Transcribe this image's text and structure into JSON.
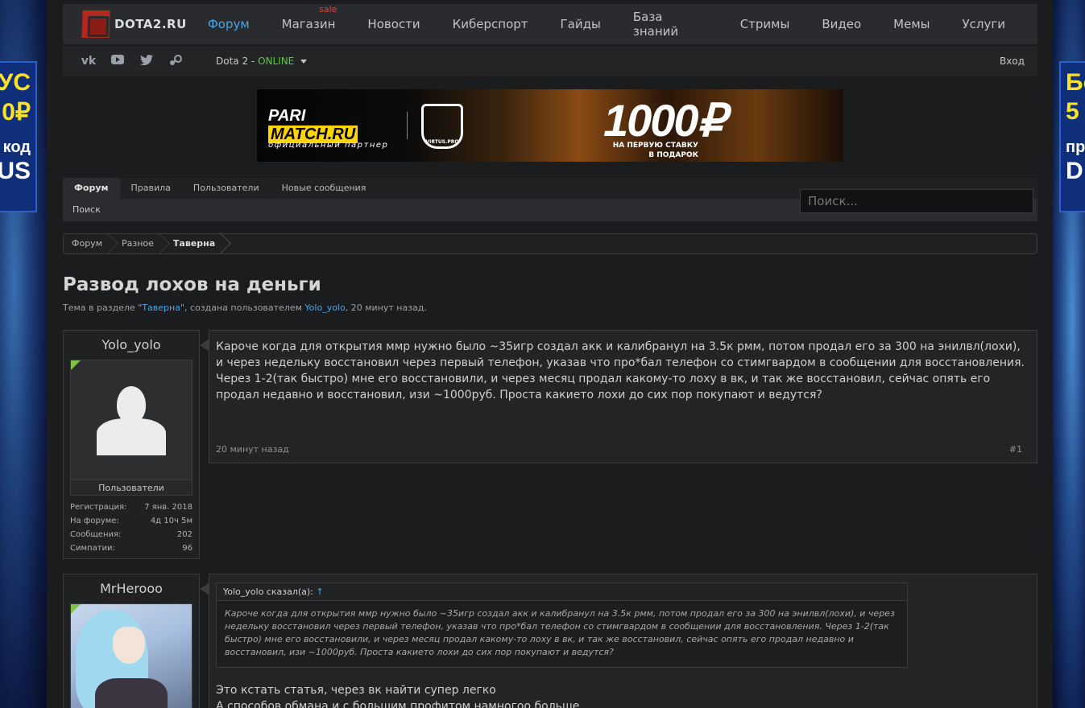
{
  "side_ads": {
    "left": {
      "line1": "УС",
      "line2": "0₽",
      "line3": "код",
      "line4": "US"
    },
    "right": {
      "line1": "Бо",
      "line2": "5",
      "line3": "пр",
      "line4": "D"
    }
  },
  "header": {
    "logo_text": "DOTA2.RU",
    "nav": [
      {
        "label": "Форум",
        "active": true
      },
      {
        "label": "Магазин",
        "badge": "sale"
      },
      {
        "label": "Новости"
      },
      {
        "label": "Киберспорт"
      },
      {
        "label": "Гайды"
      },
      {
        "label": "База знаний"
      },
      {
        "label": "Стримы"
      },
      {
        "label": "Видео"
      },
      {
        "label": "Мемы"
      },
      {
        "label": "Услуги"
      }
    ],
    "status_prefix": "Dota 2 - ",
    "status_value": "ONLINE",
    "login": "Вход"
  },
  "ad": {
    "brand1": "PARI",
    "brand2": "MATCH.RU",
    "partner": "официальный партнер",
    "team": "VIRTUS.PRO",
    "amount": "1000₽",
    "line1": "НА ПЕРВУЮ СТАВКУ",
    "line2": "В ПОДАРОК"
  },
  "forum_nav": {
    "tabs": [
      "Форум",
      "Правила",
      "Пользователи",
      "Новые сообщения"
    ],
    "sub": "Поиск",
    "search_placeholder": "Поиск..."
  },
  "breadcrumb": [
    "Форум",
    "Разное",
    "Таверна"
  ],
  "thread": {
    "title": "Развод лохов на деньги",
    "meta_prefix": "Тема в разделе \"",
    "meta_section": "Таверна",
    "meta_mid": "\", создана пользователем ",
    "meta_user": "Yolo_yolo",
    "meta_suffix": ", 20 минут назад."
  },
  "posts": [
    {
      "username": "Yolo_yolo",
      "group": "Пользователи",
      "stats": [
        {
          "label": "Регистрация:",
          "value": "7 янв. 2018"
        },
        {
          "label": "На форуме:",
          "value": "4д 10ч 5м"
        },
        {
          "label": "Сообщения:",
          "value": "202"
        },
        {
          "label": "Симпатии:",
          "value": "96"
        }
      ],
      "text": "Кароче когда для открытия ммр нужно было ~35игр создал акк и калибранул на 3.5к рмм, потом продал его за 300 на энилвл(лохи), и через недельку восстановил через первый телефон, указав что про*бал телефон со стимгвардом в сообщении для восстановления. Через 1-2(так быстро) мне его восстановили, и через месяц продал какому-то лоху в вк, и так же восстановил, сейчас опять его продал недавно и восстановил, изи ~1000руб. Проста какието лохи до сих пор покупают и ведутся?",
      "time": "20 минут назад",
      "number": "#1"
    },
    {
      "username": "MrHerooo",
      "quote_author": "Yolo_yolo сказал(а):",
      "quote_arrow": "↑",
      "quote_text": "Кароче когда для открытия ммр нужно было ~35игр создал акк и калибранул на 3.5к рмм, потом продал его за 300 на энилвл(лохи), и через недельку восстановил через первый телефон, указав что про*бал телефон со стимгвардом в сообщении для восстановления. Через 1-2(так быстро) мне его восстановили, и через месяц продал какому-то лоху в вк, и так же восстановил, сейчас опять его продал недавно и восстановил, изи ~1000руб. Проста какието лохи до сих пор покупают и ведутся?",
      "line1": "Это кстать статья, через вк найти супер легко",
      "line2": "А способов обмана и с большим профитом намногоо больше"
    }
  ]
}
